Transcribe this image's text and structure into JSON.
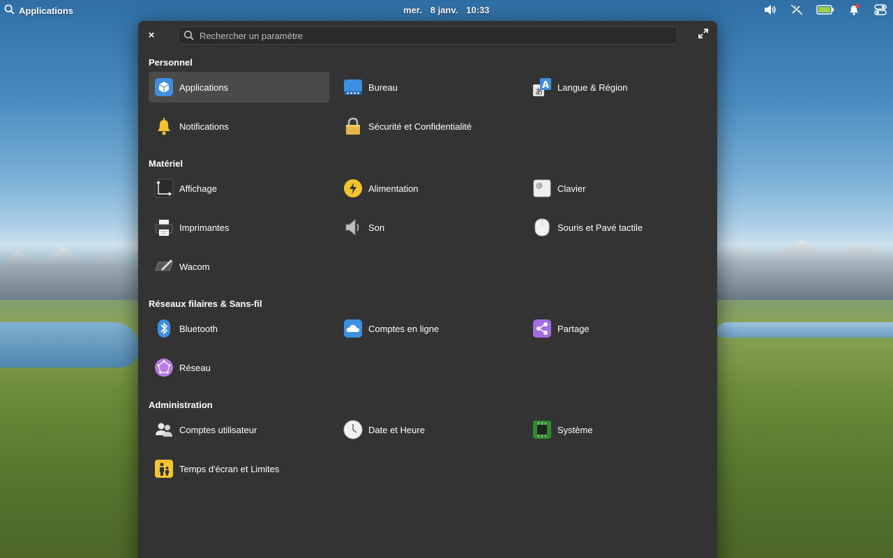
{
  "topbar": {
    "apps_label": "Applications",
    "date_day": "mer.",
    "date_text": "8 janv.",
    "time": "10:33",
    "battery_color": "#9bd04a",
    "notification_dot_color": "#e0403a"
  },
  "window": {
    "search_placeholder": "Rechercher un paramètre",
    "close_glyph": "×",
    "sections": {
      "personnel": "Personnel",
      "materiel": "Matériel",
      "reseaux": "Réseaux filaires & Sans-fil",
      "administration": "Administration"
    },
    "items": {
      "applications": "Applications",
      "bureau": "Bureau",
      "langue": "Langue & Région",
      "notifications": "Notifications",
      "securite": "Sécurité et Confidentialité",
      "affichage": "Affichage",
      "alimentation": "Alimentation",
      "clavier": "Clavier",
      "imprimantes": "Imprimantes",
      "son": "Son",
      "souris": "Souris et Pavé tactile",
      "wacom": "Wacom",
      "bluetooth": "Bluetooth",
      "comptes_en_ligne": "Comptes en ligne",
      "partage": "Partage",
      "reseau": "Réseau",
      "comptes_utilisateur": "Comptes utilisateur",
      "date_heure": "Date et Heure",
      "systeme": "Système",
      "temps_ecran": "Temps d'écran et Limites"
    },
    "selected_item": "applications",
    "colors": {
      "window_bg": "#333333",
      "selected_bg": "#4a4a4a",
      "accent_blue": "#3d8fe0"
    }
  }
}
